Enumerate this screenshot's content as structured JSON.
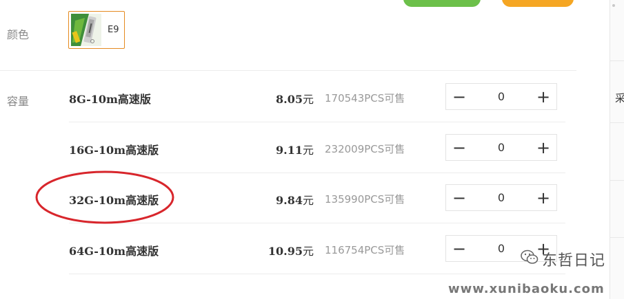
{
  "color_section": {
    "label": "颜色",
    "swatch_label": "E9",
    "selected_border_color": "#e58a1f"
  },
  "capacity_section": {
    "label": "容量",
    "rows": [
      {
        "name": "8G-10m高速版",
        "price": "8.05",
        "currency": "元",
        "stock": "170543PCS可售",
        "qty": "0"
      },
      {
        "name": "16G-10m高速版",
        "price": "9.11",
        "currency": "元",
        "stock": "232009PCS可售",
        "qty": "0"
      },
      {
        "name": "32G-10m高速版",
        "price": "9.84",
        "currency": "元",
        "stock": "135990PCS可售",
        "qty": "0"
      },
      {
        "name": "64G-10m高速版",
        "price": "10.95",
        "currency": "元",
        "stock": "116754PCS可售",
        "qty": "0"
      }
    ],
    "stepper_minus": "−",
    "stepper_plus": "+",
    "highlight_color": "#d8262c"
  },
  "right_panel": {
    "glyph": "采"
  },
  "watermark": {
    "name": "东哲日记",
    "url": "www.xunibaoku.com",
    "icon": "wechat-icon"
  },
  "colors": {
    "green_button": "#6cc04a",
    "orange_button": "#f5a623"
  }
}
